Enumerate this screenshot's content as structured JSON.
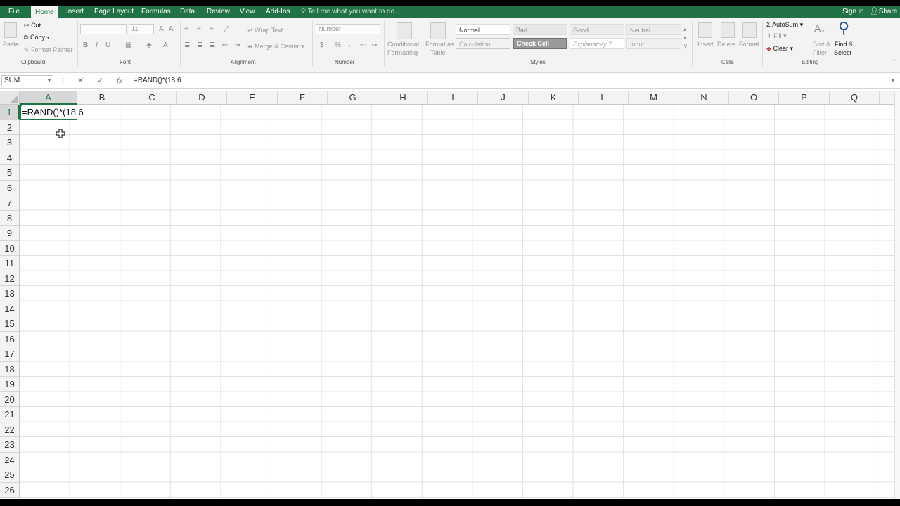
{
  "tabs": [
    "File",
    "Home",
    "Insert",
    "Page Layout",
    "Formulas",
    "Data",
    "Review",
    "View",
    "Add-Ins"
  ],
  "active_tab": "Home",
  "tell_me": "Tell me what you want to do...",
  "top_right": {
    "sign_in": "Sign in",
    "share": "Share"
  },
  "clipboard": {
    "paste": "Paste",
    "cut": "Cut",
    "copy": "Copy",
    "format_painter": "Format Painter",
    "label": "Clipboard"
  },
  "font": {
    "name": "",
    "size": "11",
    "bold": "B",
    "italic": "I",
    "underline": "U",
    "label": "Font"
  },
  "alignment": {
    "wrap_text": "Wrap Text",
    "merge_center": "Merge & Center",
    "label": "Alignment"
  },
  "number": {
    "format": "Number",
    "currency": "$",
    "percent": "%",
    "label": "Number"
  },
  "styles": {
    "conditional_formatting": [
      "Conditional",
      "Formatting"
    ],
    "format_as_table": [
      "Format as",
      "Table"
    ],
    "cells": [
      "Normal",
      "Bad",
      "Good",
      "Neutral",
      "Calculation",
      "Check Cell",
      "Explanatory T...",
      "Input"
    ],
    "label": "Styles"
  },
  "cells_group": {
    "insert": "Insert",
    "delete": "Delete",
    "format": "Format",
    "label": "Cells"
  },
  "editing": {
    "autosum": "AutoSum",
    "fill": "Fill",
    "clear": "Clear",
    "sort_filter": [
      "Sort &",
      "Filter"
    ],
    "find_select": [
      "Find &",
      "Select"
    ],
    "label": "Editing"
  },
  "formula_bar": {
    "name_box": "SUM",
    "cancel": "✕",
    "enter": "✓",
    "fx": "fx",
    "content": "=RAND()*(18.6"
  },
  "columns": [
    "A",
    "B",
    "C",
    "D",
    "E",
    "F",
    "G",
    "H",
    "I",
    "J",
    "K",
    "L",
    "M",
    "N",
    "O",
    "P",
    "Q"
  ],
  "rows": [
    "1",
    "2",
    "3",
    "4",
    "5",
    "6",
    "7",
    "8",
    "9",
    "10",
    "11",
    "12",
    "13",
    "14",
    "15",
    "16",
    "17",
    "18",
    "19",
    "20",
    "21",
    "22",
    "23",
    "24",
    "25",
    "26"
  ],
  "active_cell": {
    "ref": "A1",
    "text": "=RAND()*(18.6"
  }
}
